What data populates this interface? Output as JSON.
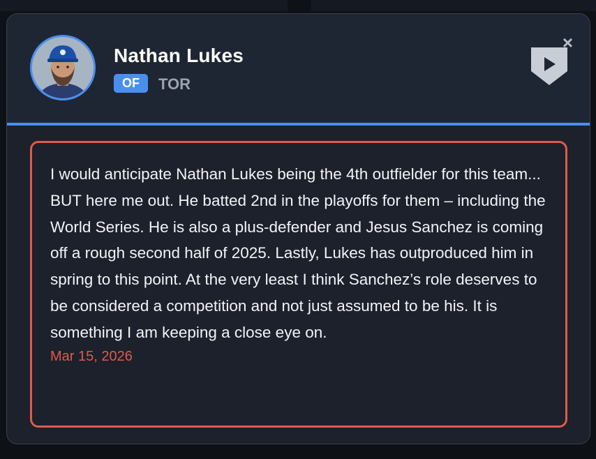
{
  "player": {
    "name": "Nathan Lukes",
    "position": "OF",
    "team": "TOR"
  },
  "note": {
    "text": "I would anticipate Nathan Lukes being the 4th outfielder for this team... BUT here me out. He batted 2nd in the playoffs for them – including the World Series. He is also a plus-defender and Jesus Sanchez is coming off a rough second half of 2025. Lastly, Lukes has outproduced him in spring to this point. At the very least I think Sanchez’s role deserves to be considered a competition and not just assumed to be his. It is something I am keeping a close eye on.",
    "date": "Mar 15, 2026"
  },
  "controls": {
    "close_symbol": "×"
  },
  "icons": {
    "close": "close-icon",
    "logo": "home-plate-play-icon",
    "avatar": "player-headshot"
  },
  "colors": {
    "accent": "#4a8ff0",
    "note_border": "#e05a4c",
    "card_bg": "#1c212b",
    "header_bg": "#1f2633"
  }
}
